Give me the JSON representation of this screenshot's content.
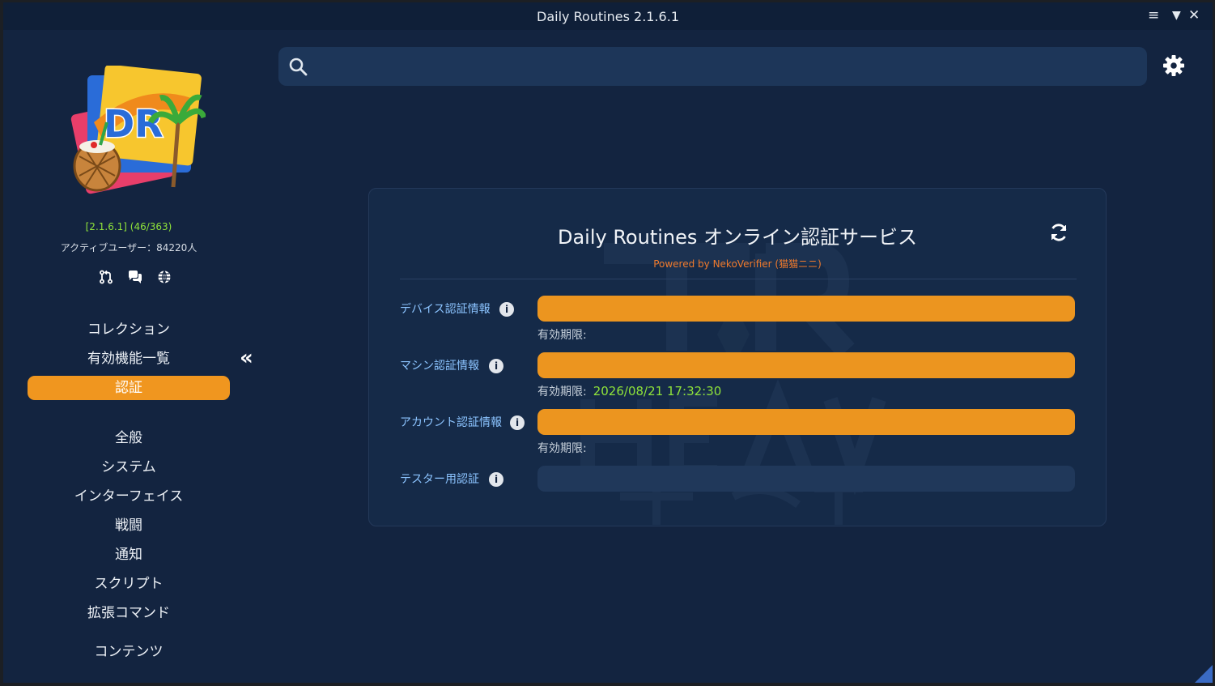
{
  "window": {
    "title": "Daily Routines 2.1.6.1",
    "controls": [
      "≡",
      "▼",
      "✕"
    ]
  },
  "sidebar": {
    "version": "[2.1.6.1] (46/363)",
    "active_users": "アクティブユーザー：84220人",
    "icons": [
      "git-pull-request-icon",
      "chat-icon",
      "globe-icon"
    ],
    "top_items": [
      {
        "label": "コレクション"
      },
      {
        "label": "有効機能一覧"
      },
      {
        "label": "認証",
        "active": true
      }
    ],
    "items": [
      {
        "label": "全般"
      },
      {
        "label": "システム"
      },
      {
        "label": "インターフェイス"
      },
      {
        "label": "戦闘"
      },
      {
        "label": "通知"
      },
      {
        "label": "スクリプト"
      },
      {
        "label": "拡張コマンド"
      },
      {
        "label": "コンテンツ"
      }
    ],
    "collapse_glyph": "«"
  },
  "search": {
    "value": "",
    "placeholder": ""
  },
  "panel": {
    "title": "Daily Routines オンライン認証サービス",
    "powered_by": "Powered by NekoVerifier (猫猫ニニ)",
    "rows": [
      {
        "label": "デバイス認証情報",
        "expiry_label": "有効期限:",
        "expiry_value": ""
      },
      {
        "label": "マシン認証情報",
        "expiry_label": "有効期限:",
        "expiry_value": "2026/08/21 17:32:30"
      },
      {
        "label": "アカウント認証情報",
        "expiry_label": "有効期限:",
        "expiry_value": ""
      },
      {
        "label": "テスター用認証"
      }
    ],
    "info_glyph": "i"
  },
  "colors": {
    "accent": "#f0961f",
    "background": "#132440",
    "label_blue": "#8cc4ff",
    "version_green": "#8fe33a",
    "powered_orange": "#f07a2c"
  }
}
